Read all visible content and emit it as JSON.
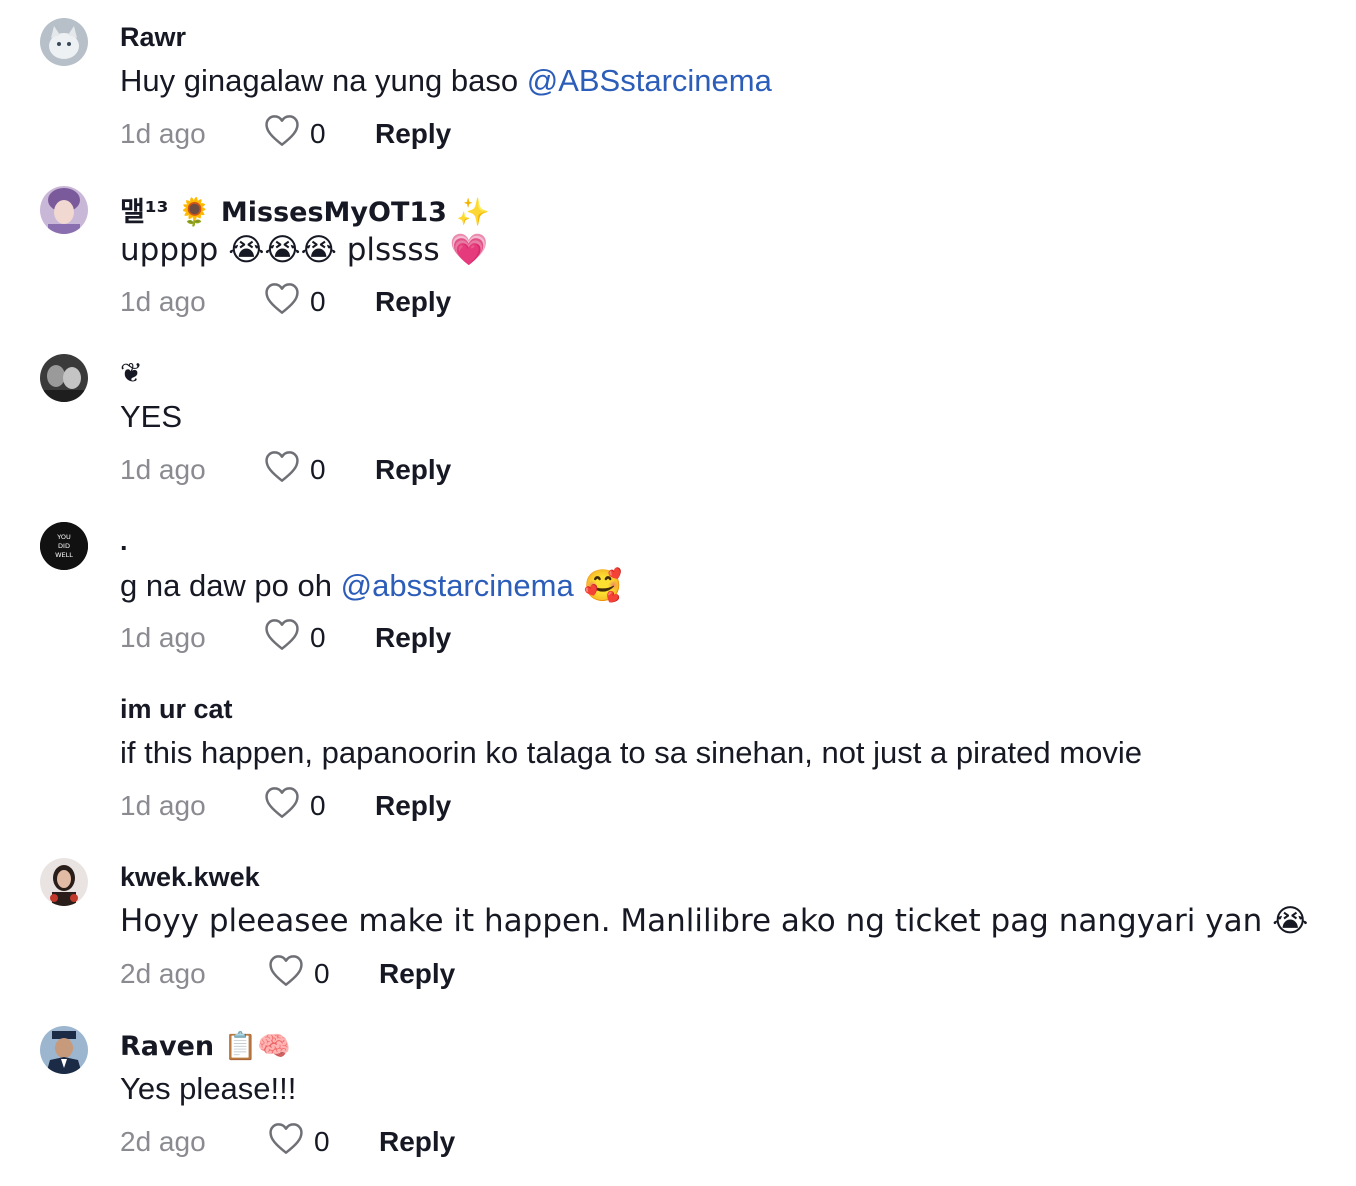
{
  "comments": [
    {
      "username": "Rawr",
      "text": "Huy ginagalaw na yung baso ",
      "mention": "@ABSstarcinema",
      "emoji": "",
      "time": "1d ago",
      "likes": "0",
      "reply": "Reply"
    },
    {
      "username": "맬¹³ 🌻 MissesMyOT13 ✨",
      "text": "upppp 😭😭😭 plssss 💗",
      "mention": "",
      "emoji": "",
      "time": "1d ago",
      "likes": "0",
      "reply": "Reply"
    },
    {
      "username": "❦",
      "text": "YES",
      "mention": "",
      "emoji": "",
      "time": "1d ago",
      "likes": "0",
      "reply": "Reply"
    },
    {
      "username": ".",
      "text": "g na daw po oh ",
      "mention": "@absstarcinema",
      "emoji": " 🥰",
      "time": "1d ago",
      "likes": "0",
      "reply": "Reply",
      "avatar_text": [
        "YOU",
        "DID",
        "WELL"
      ]
    },
    {
      "username": "im ur cat",
      "text": "if this happen, papanoorin ko talaga to sa sinehan, not just a pirated movie",
      "mention": "",
      "emoji": "",
      "time": "1d ago",
      "likes": "0",
      "reply": "Reply"
    },
    {
      "username": "kwek.kwek",
      "text": "Hoyy pleeasee make it happen. Manlilibre ako ng ticket pag nangyari yan 😭",
      "mention": "",
      "emoji": "",
      "time": "2d ago",
      "likes": "0",
      "reply": "Reply"
    },
    {
      "username": "Raven 📋🧠",
      "text": "Yes please!!!",
      "mention": "",
      "emoji": "",
      "time": "2d ago",
      "likes": "0",
      "reply": "Reply"
    }
  ],
  "colors": {
    "mention": "#2b5db9",
    "time": "#8a8b91",
    "text": "#161823"
  },
  "icons": {
    "like": "heart-outline-icon"
  }
}
